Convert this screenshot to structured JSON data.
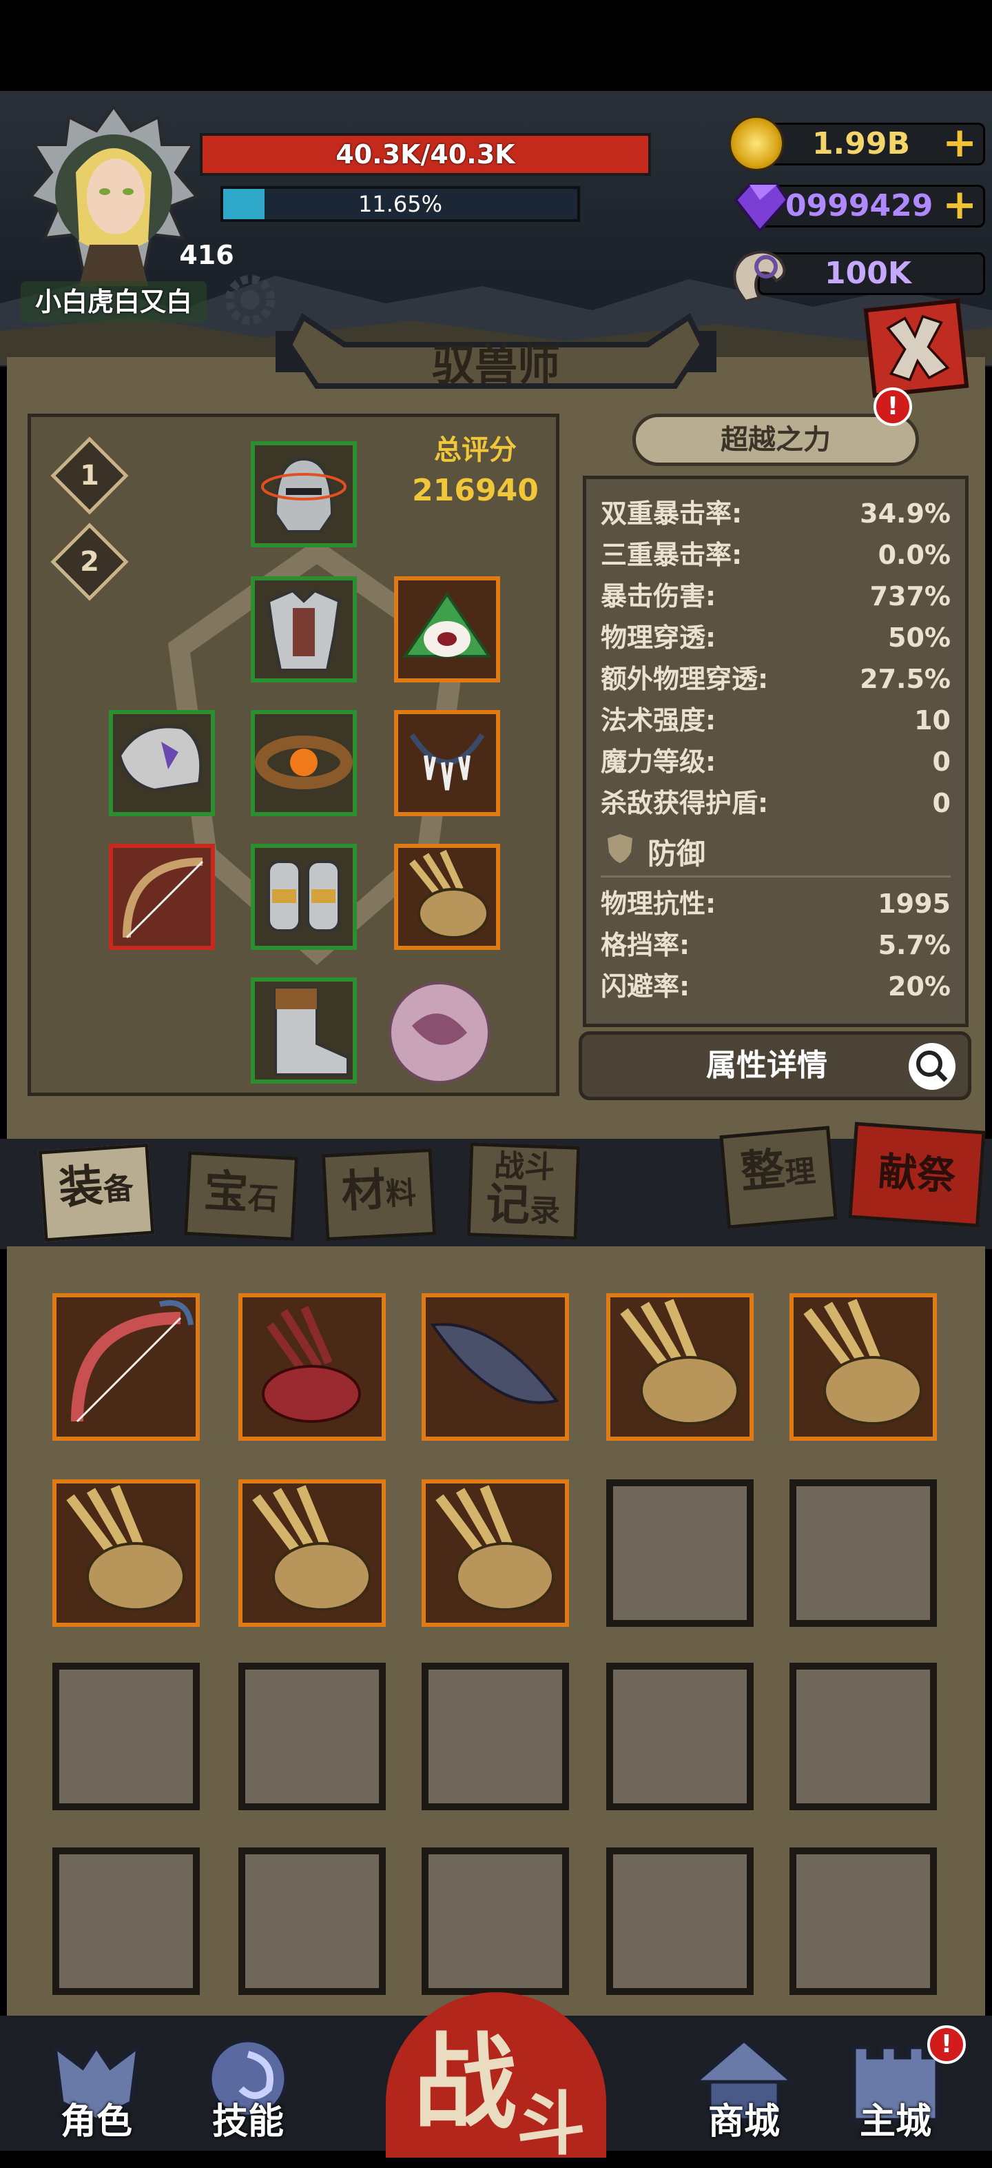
{
  "player": {
    "name": "小白虎白又白",
    "level": "416",
    "hp_text": "40.3K/40.3K",
    "xp_text": "11.65%",
    "xp_fraction": 0.1165
  },
  "currencies": {
    "gold": "1.99B",
    "gems": "0999429",
    "horns": "100K"
  },
  "panel": {
    "title": "驭兽师",
    "score_label": "总评分",
    "score_value": "216940",
    "loadout_1": "1",
    "loadout_2": "2",
    "transcend_label": "超越之力",
    "details_label": "属性详情",
    "defense_title": "防御"
  },
  "stats": [
    {
      "label": "双重暴击率:",
      "value": "34.9%"
    },
    {
      "label": "三重暴击率:",
      "value": "0.0%"
    },
    {
      "label": "暴击伤害:",
      "value": "737%"
    },
    {
      "label": "物理穿透:",
      "value": "50%"
    },
    {
      "label": "额外物理穿透:",
      "value": "27.5%"
    },
    {
      "label": "法术强度:",
      "value": "10"
    },
    {
      "label": "魔力等级:",
      "value": "0"
    },
    {
      "label": "杀敌获得护盾:",
      "value": "0"
    }
  ],
  "defense_stats": [
    {
      "label": "物理抗性:",
      "value": "1995"
    },
    {
      "label": "格挡率:",
      "value": "5.7%"
    },
    {
      "label": "闪避率:",
      "value": "20%"
    }
  ],
  "tabs": {
    "equip_big": "装",
    "equip_small": "备",
    "gem_big": "宝",
    "gem_small": "石",
    "material_big": "材",
    "material_small": "料",
    "log_top": "战斗",
    "log_big": "记",
    "log_small": "录",
    "sort_big": "整",
    "sort_small": "理",
    "sacrifice": "献祭"
  },
  "nav": {
    "character": "角色",
    "skills": "技能",
    "battle_big": "战",
    "battle_small": "斗",
    "shop": "商城",
    "main_city": "主城"
  },
  "badges": {
    "alert": "!"
  },
  "colors": {
    "hp": "#c42a1c",
    "xp": "#2ea7c9",
    "gold_text": "#f3d56a",
    "rare_green": "#2b8f2f",
    "legendary_orange": "#e07a14",
    "epic_red": "#c8281e"
  }
}
